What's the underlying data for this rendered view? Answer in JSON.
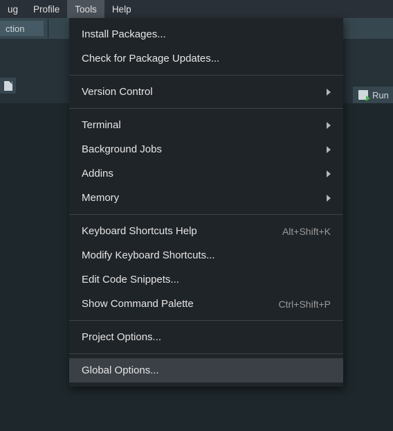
{
  "menubar": {
    "items": [
      {
        "label": "ug"
      },
      {
        "label": "Profile"
      },
      {
        "label": "Tools"
      },
      {
        "label": "Help"
      }
    ],
    "open_index": 2
  },
  "toolbar": {
    "selector_label": "ction"
  },
  "run_button": {
    "label": "Run"
  },
  "tools_menu": {
    "groups": [
      [
        {
          "label": "Install Packages...",
          "submenu": false,
          "shortcut": ""
        },
        {
          "label": "Check for Package Updates...",
          "submenu": false,
          "shortcut": ""
        }
      ],
      [
        {
          "label": "Version Control",
          "submenu": true,
          "shortcut": ""
        }
      ],
      [
        {
          "label": "Terminal",
          "submenu": true,
          "shortcut": ""
        },
        {
          "label": "Background Jobs",
          "submenu": true,
          "shortcut": ""
        },
        {
          "label": "Addins",
          "submenu": true,
          "shortcut": ""
        },
        {
          "label": "Memory",
          "submenu": true,
          "shortcut": ""
        }
      ],
      [
        {
          "label": "Keyboard Shortcuts Help",
          "submenu": false,
          "shortcut": "Alt+Shift+K"
        },
        {
          "label": "Modify Keyboard Shortcuts...",
          "submenu": false,
          "shortcut": ""
        },
        {
          "label": "Edit Code Snippets...",
          "submenu": false,
          "shortcut": ""
        },
        {
          "label": "Show Command Palette",
          "submenu": false,
          "shortcut": "Ctrl+Shift+P"
        }
      ],
      [
        {
          "label": "Project Options...",
          "submenu": false,
          "shortcut": ""
        }
      ],
      [
        {
          "label": "Global Options...",
          "submenu": false,
          "shortcut": "",
          "hovered": true
        }
      ]
    ]
  }
}
